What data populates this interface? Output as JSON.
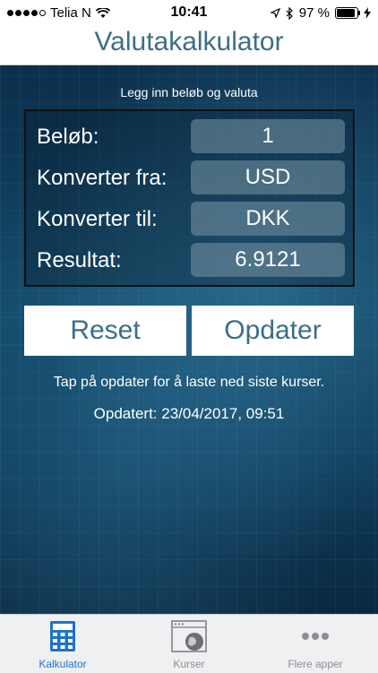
{
  "status_bar": {
    "carrier": "Telia N",
    "time": "10:41",
    "battery_percent": "97 %"
  },
  "nav": {
    "title": "Valutakalkulator"
  },
  "main": {
    "hint": "Legg inn beløb og valuta",
    "rows": [
      {
        "label": "Beløb:",
        "value": "1"
      },
      {
        "label": "Konverter fra:",
        "value": "USD"
      },
      {
        "label": "Konverter til:",
        "value": "DKK"
      },
      {
        "label": "Resultat:",
        "value": "6.9121"
      }
    ],
    "reset_label": "Reset",
    "update_label": "Opdater",
    "tip": "Tap på opdater for å laste ned siste kurser.",
    "updated": "Opdatert: 23/04/2017, 09:51"
  },
  "tabbar": {
    "tabs": [
      {
        "label": "Kalkulator",
        "icon": "calculator-icon",
        "active": true
      },
      {
        "label": "Kurser",
        "icon": "globe-window-icon",
        "active": false
      },
      {
        "label": "Flere apper",
        "icon": "more-dots-icon",
        "active": false
      }
    ]
  },
  "colors": {
    "accent": "#3b6f86",
    "active_tab": "#1e73c8",
    "background": "#0f3d5c"
  }
}
